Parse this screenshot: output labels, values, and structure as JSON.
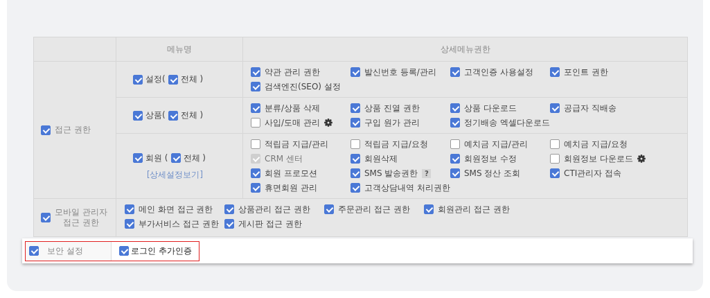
{
  "table": {
    "columns": [
      "메뉴명",
      "상세메뉴권한"
    ],
    "access": {
      "label": "접근 권한",
      "checked": true,
      "menus": [
        {
          "name": "설정(",
          "checked": true,
          "all_label": "전체 )",
          "all_checked": true,
          "items": [
            {
              "label": "약관 관리 권한",
              "checked": true,
              "disabled": false
            },
            {
              "label": "발신번호 등록/관리",
              "checked": true,
              "disabled": false
            },
            {
              "label": "고객인증 사용설정",
              "checked": true,
              "disabled": false
            },
            {
              "label": "포인트 권한",
              "checked": true,
              "disabled": false
            },
            {
              "label": "검색엔진(SEO) 설정",
              "checked": true,
              "disabled": false
            }
          ]
        },
        {
          "name": "상품(",
          "checked": true,
          "all_label": "전체 )",
          "all_checked": true,
          "items": [
            {
              "label": "분류/상품 삭제",
              "checked": true,
              "disabled": false
            },
            {
              "label": "상품 진열 권한",
              "checked": true,
              "disabled": false
            },
            {
              "label": "상품 다운로드",
              "checked": true,
              "disabled": false
            },
            {
              "label": "공급자 직배송",
              "checked": true,
              "disabled": false
            },
            {
              "label": "사입/도매 관리",
              "checked": false,
              "disabled": false,
              "kind": "gear"
            },
            {
              "label": "구입 원가 관리",
              "checked": true,
              "disabled": false
            },
            {
              "label": "정기배송 엑셀다운로드",
              "checked": true,
              "disabled": false
            }
          ]
        },
        {
          "name": "회원 (",
          "checked": true,
          "all_label": "전체 )",
          "all_checked": true,
          "link": "[상세설정보기]",
          "items": [
            {
              "label": "적립금 지급/관리",
              "checked": false,
              "disabled": false
            },
            {
              "label": "적립금 지급/요청",
              "checked": false,
              "disabled": false
            },
            {
              "label": "예치금 지급/관리",
              "checked": false,
              "disabled": false
            },
            {
              "label": "예치금 지급/요청",
              "checked": false,
              "disabled": false
            },
            {
              "label": "CRM 센터",
              "checked": true,
              "disabled": true
            },
            {
              "label": "회원삭제",
              "checked": true,
              "disabled": false
            },
            {
              "label": "회원정보 수정",
              "checked": true,
              "disabled": false
            },
            {
              "label": "회원정보 다운로드",
              "checked": false,
              "disabled": false,
              "kind": "gear"
            },
            {
              "label": "회원 프로모션",
              "checked": true,
              "disabled": false
            },
            {
              "label": "SMS 발송권한",
              "checked": true,
              "disabled": false,
              "kind": "help",
              "help": "?"
            },
            {
              "label": "SMS 정산 조회",
              "checked": true,
              "disabled": false
            },
            {
              "label": "CTI관리자 접속",
              "checked": true,
              "disabled": false
            },
            {
              "label": "휴면회원 관리",
              "checked": true,
              "disabled": false
            },
            {
              "label": "고객상담내역 처리권한",
              "checked": true,
              "disabled": false
            }
          ]
        }
      ]
    },
    "mobile": {
      "label_lines": [
        "모바일 관리자",
        "접근 권한"
      ],
      "checked": true,
      "items": [
        {
          "label": "메인 화면 접근 권한",
          "checked": true,
          "disabled": false
        },
        {
          "label": "상품관리 접근 권한",
          "checked": true,
          "disabled": false
        },
        {
          "label": "주문관리 접근 권한",
          "checked": true,
          "disabled": false
        },
        {
          "label": "회원관리 접근 권한",
          "checked": true,
          "disabled": false
        },
        {
          "label": "부가서비스 접근 권한",
          "checked": true,
          "disabled": false
        },
        {
          "label": "게시판 접근 권한",
          "checked": true,
          "disabled": false
        }
      ]
    }
  },
  "security": {
    "label": "보안 설정",
    "checked": true,
    "item": {
      "label": "로그인 추가인증",
      "checked": true
    }
  }
}
